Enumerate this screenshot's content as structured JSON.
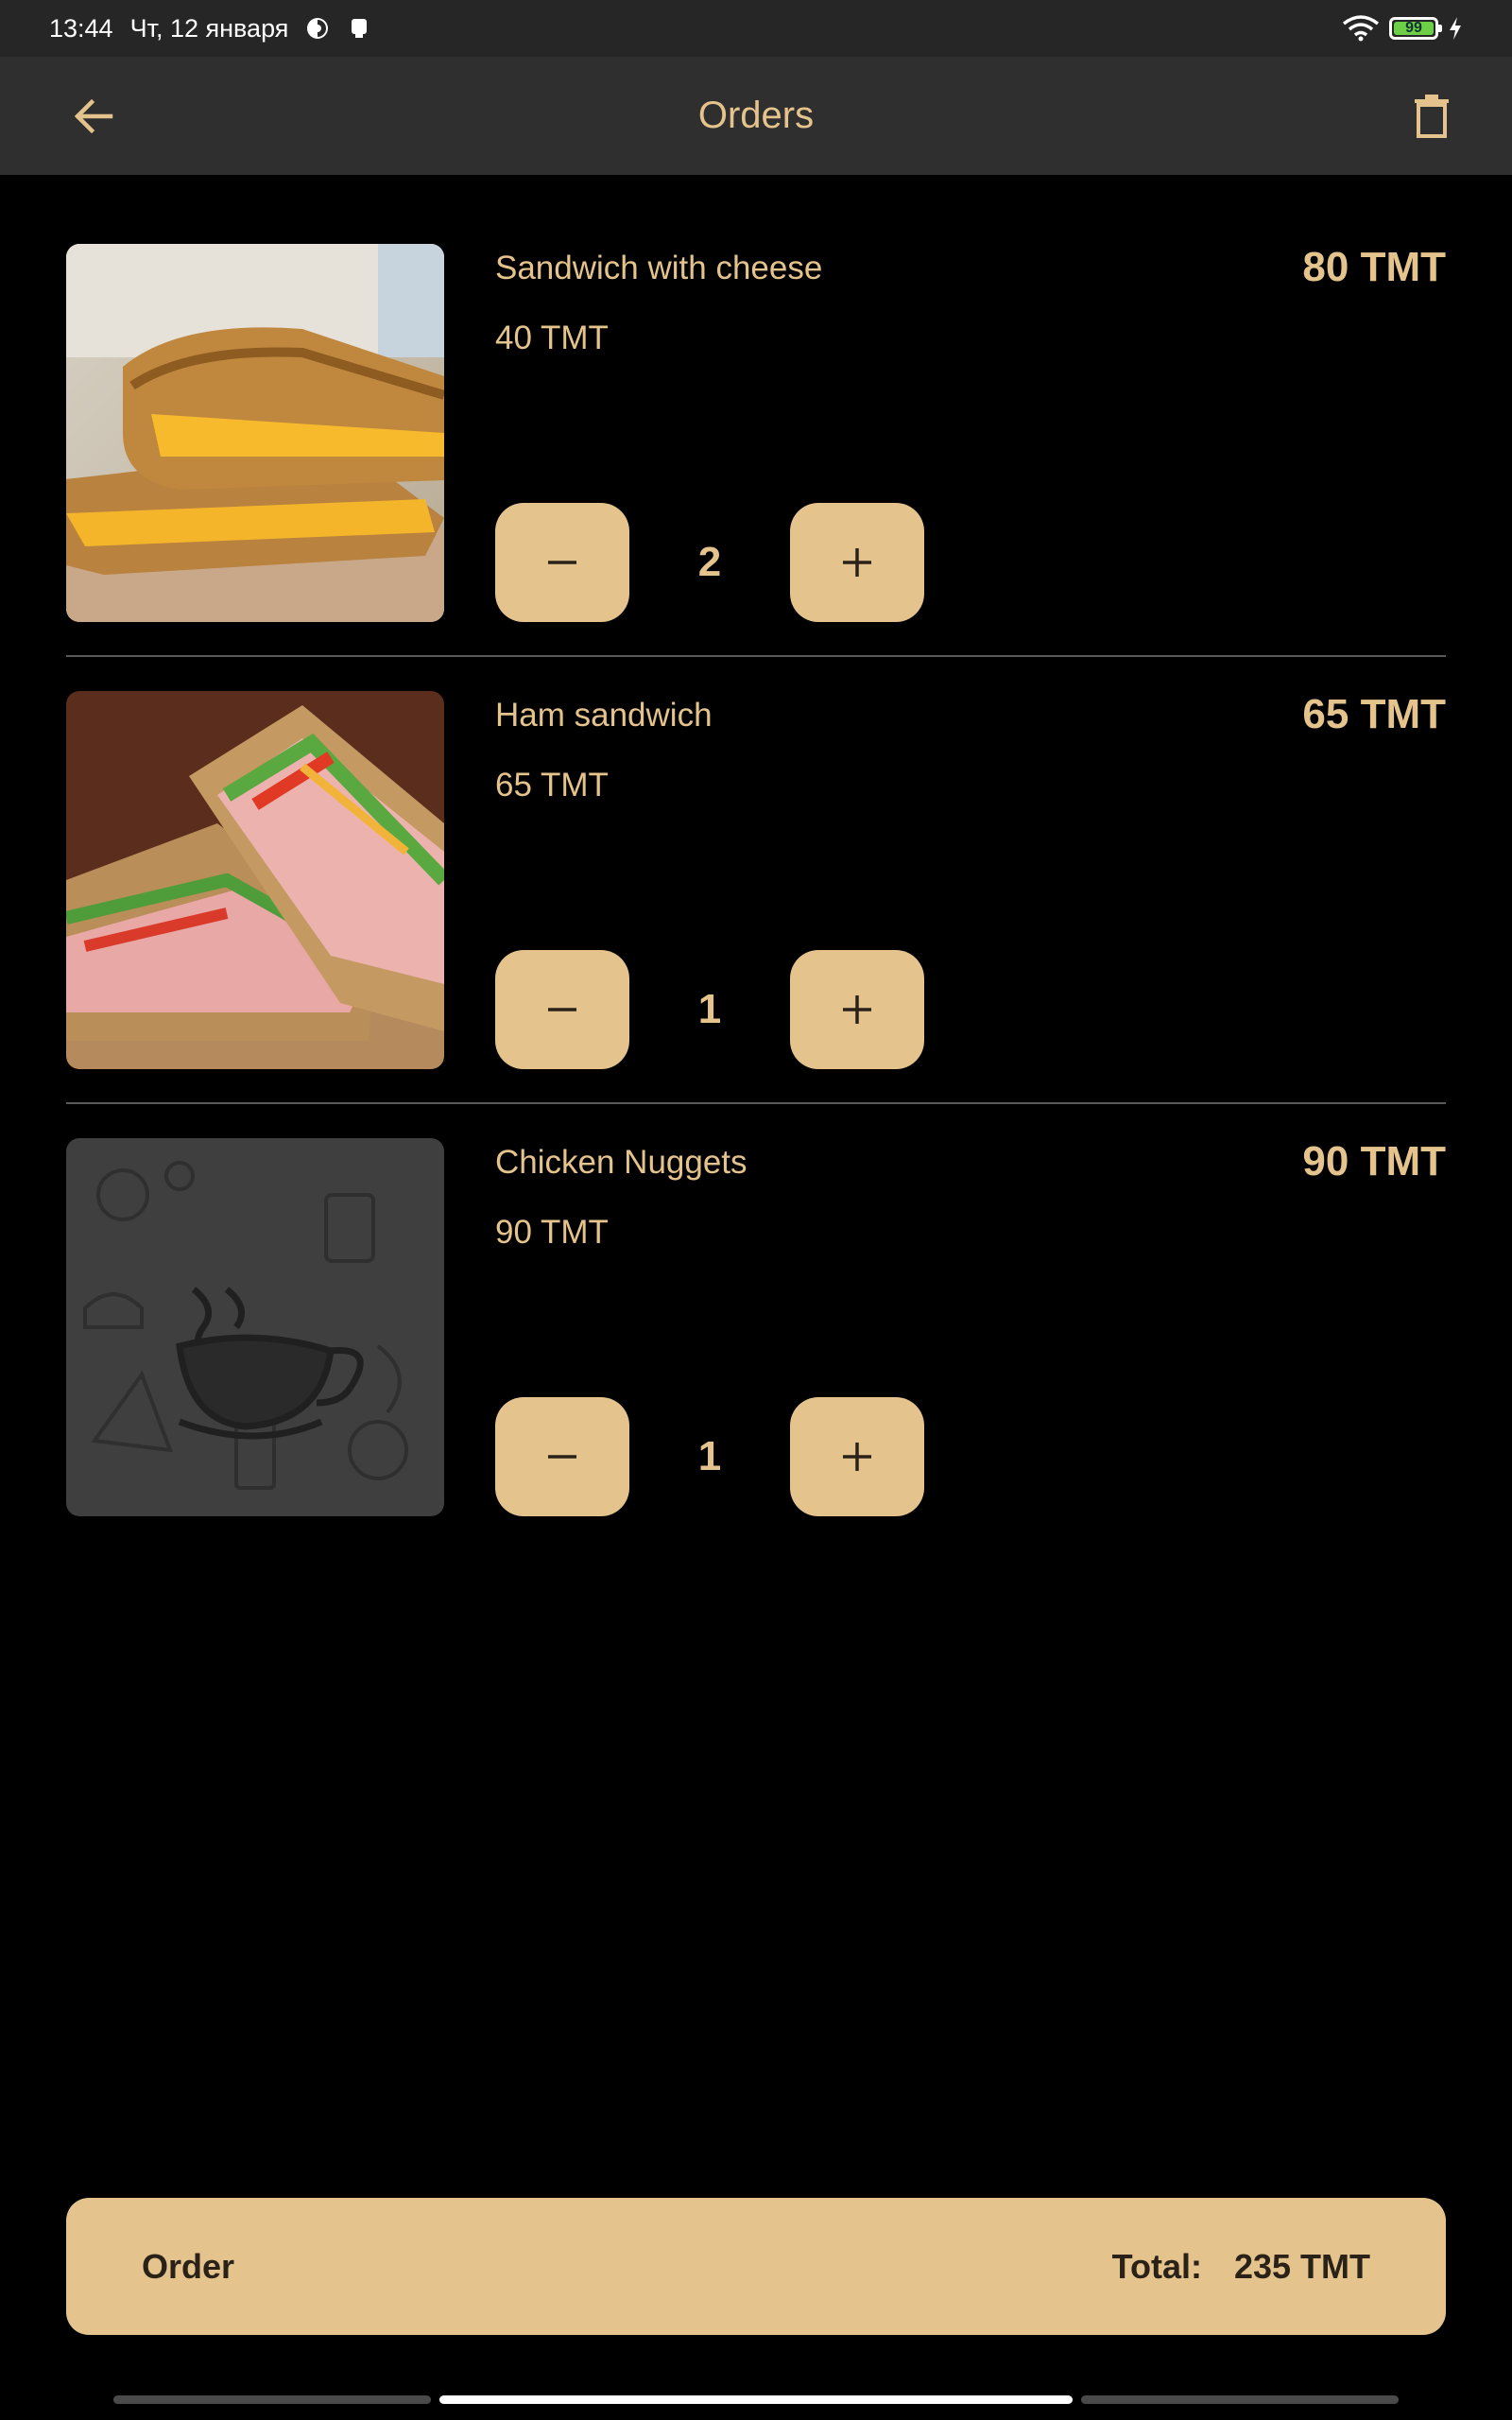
{
  "status_bar": {
    "time": "13:44",
    "date": "Чт, 12 января",
    "battery_level": "99"
  },
  "header": {
    "title": "Orders"
  },
  "orders": [
    {
      "name": "Sandwich with cheese",
      "unit_price": "40 TMT",
      "total": "80 TMT",
      "quantity": "2",
      "minus": "−",
      "plus": "+"
    },
    {
      "name": "Ham sandwich",
      "unit_price": "65 TMT",
      "total": "65 TMT",
      "quantity": "1",
      "minus": "−",
      "plus": "+"
    },
    {
      "name": "Chicken Nuggets",
      "unit_price": "90 TMT",
      "total": "90 TMT",
      "quantity": "1",
      "minus": "−",
      "plus": "+"
    }
  ],
  "footer": {
    "order_label": "Order",
    "total_label": "Total:",
    "total_value": "235 TMT"
  },
  "colors": {
    "accent": "#e5c38c",
    "background": "#000000",
    "app_bar": "#2f2f2f"
  }
}
